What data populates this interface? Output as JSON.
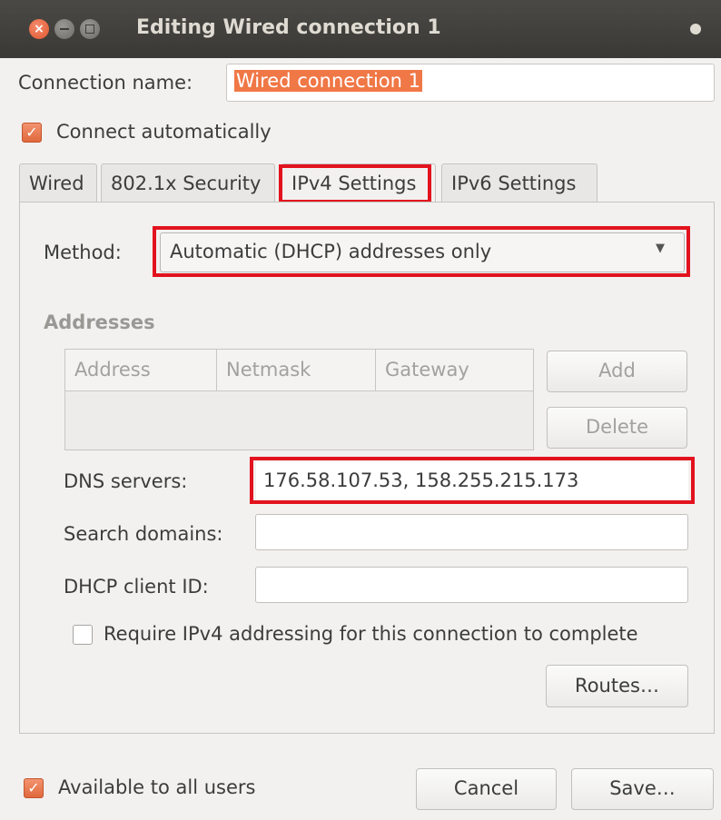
{
  "window": {
    "title": "Editing Wired connection 1",
    "close_glyph": "×"
  },
  "connection_name": {
    "label": "Connection name:",
    "value": "Wired connection 1"
  },
  "connect_automatically": {
    "label": "Connect automatically",
    "checked": true
  },
  "tabs": [
    {
      "label": "Wired",
      "active": false
    },
    {
      "label": "802.1x Security",
      "active": false
    },
    {
      "label": "IPv4 Settings",
      "active": true
    },
    {
      "label": "IPv6 Settings",
      "active": false
    }
  ],
  "ipv4": {
    "method_label": "Method:",
    "method_value": "Automatic (DHCP) addresses only",
    "addresses_heading": "Addresses",
    "columns": [
      "Address",
      "Netmask",
      "Gateway"
    ],
    "add_label": "Add",
    "delete_label": "Delete",
    "dns_label": "DNS servers:",
    "dns_value": "176.58.107.53, 158.255.215.173",
    "search_label": "Search domains:",
    "search_value": "",
    "dhcp_label": "DHCP client ID:",
    "dhcp_value": "",
    "require_label": "Require IPv4 addressing for this connection to complete",
    "require_checked": false,
    "routes_label": "Routes…"
  },
  "footer": {
    "available_label": "Available to all users",
    "available_checked": true,
    "cancel_label": "Cancel",
    "save_label": "Save…"
  },
  "colors": {
    "highlight": "#e2131e",
    "accent": "#f07746",
    "titlebar": "#3c3b37"
  }
}
